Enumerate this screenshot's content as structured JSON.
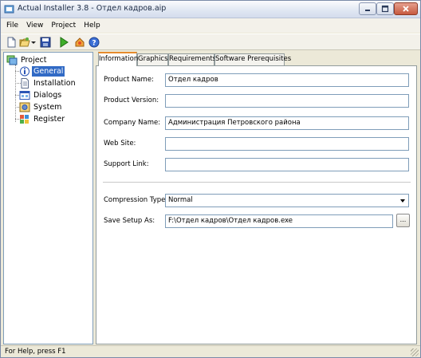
{
  "window": {
    "title": "Actual Installer 3.8 - Отдел кадров.aip"
  },
  "menu": {
    "items": [
      "File",
      "View",
      "Project",
      "Help"
    ]
  },
  "toolbar": {
    "icons": [
      "new-file-icon",
      "open-folder-icon",
      "dropdown-arrow-icon",
      "save-icon",
      "build-run-icon",
      "home-icon",
      "help-icon"
    ]
  },
  "tree": {
    "root": "Project",
    "items": [
      "General",
      "Installation",
      "Dialogs",
      "System",
      "Register"
    ],
    "selected": "General"
  },
  "tabs": [
    "Information",
    "Graphics",
    "Requirements",
    "Software Prerequisites"
  ],
  "form": {
    "product_name": {
      "label": "Product Name:",
      "value": "Отдел кадров"
    },
    "product_version": {
      "label": "Product Version:",
      "value": ""
    },
    "company_name": {
      "label": "Company Name:",
      "value": "Администрация Петровского района"
    },
    "web_site": {
      "label": "Web Site:",
      "value": ""
    },
    "support_link": {
      "label": "Support Link:",
      "value": ""
    },
    "compression_type": {
      "label": "Compression Type:",
      "value": "Normal"
    },
    "save_setup_as": {
      "label": "Save Setup As:",
      "value": "F:\\Отдел кадров\\Отдел кадров.exe"
    },
    "browse_label": "..."
  },
  "status": {
    "text": "For Help, press F1"
  },
  "colors": {
    "selection": "#316ac5",
    "active_tab_accent": "#e68b2c",
    "field_border": "#7f9db9"
  }
}
